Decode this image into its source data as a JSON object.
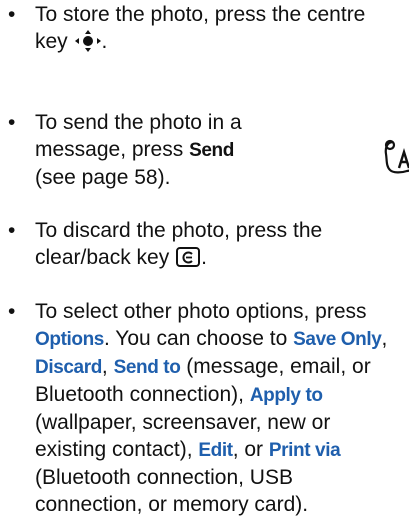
{
  "bullets": [
    {
      "pre": "To store the photo, press the centre key ",
      "post": "."
    },
    {
      "pre": "To send the photo in a message, press ",
      "kw": "Send",
      "post": " (see page 58)."
    },
    {
      "pre": "To discard the photo, press the clear/back key ",
      "post": "."
    },
    {
      "pre": "To select other photo options, press ",
      "kw_options": "Options",
      "mid1": ". You can choose to ",
      "kw_save_only": "Save Only",
      "mid2": ", ",
      "kw_discard": "Discard",
      "mid3": ", ",
      "kw_send_to": "Send to",
      "mid4": " (message, email, or Bluetooth connection), ",
      "kw_apply_to": "Apply to",
      "mid5": " (wallpaper, screensaver, new or existing contact), ",
      "kw_edit": "Edit",
      "mid6": ", or ",
      "kw_print_via": "Print via",
      "post": " (Bluetooth connection, USB connection, or memory card)."
    }
  ],
  "bullet_glyph": "•",
  "colors": {
    "text": "#111111",
    "keyword": "#1f5fad"
  },
  "icons": {
    "center_key": "nav-center-key-icon",
    "clear_key": "clear-back-key-icon",
    "side": "accessibility-margin-icon"
  }
}
